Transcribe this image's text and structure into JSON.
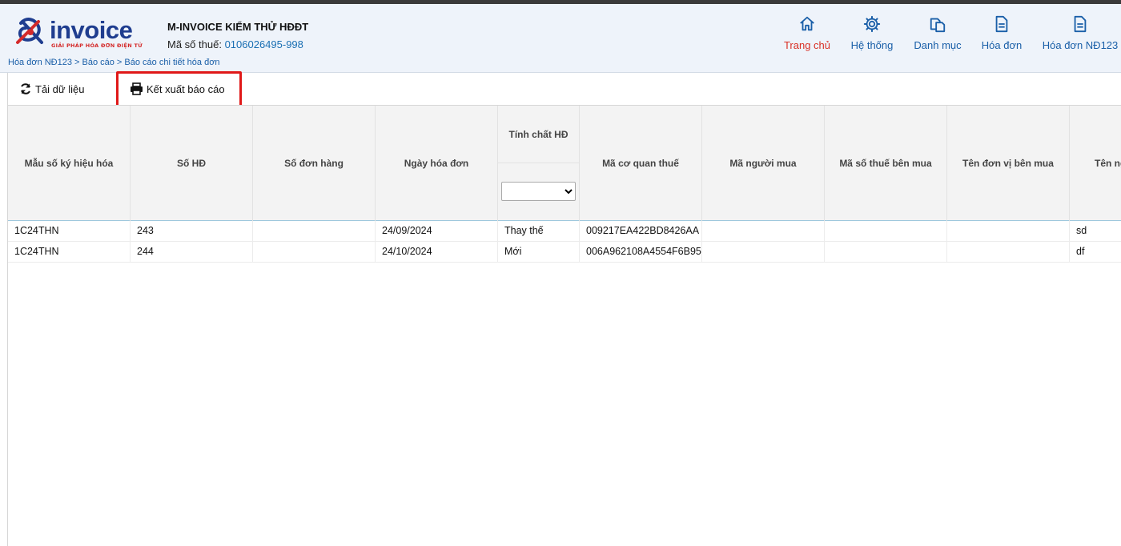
{
  "header": {
    "logo_text": "invoice",
    "logo_tagline": "GIẢI PHÁP HÓA ĐƠN ĐIỆN TỬ",
    "company_name": "M-INVOICE KIỂM THỬ HĐĐT",
    "tax_label": "Mã số thuế:",
    "tax_code": "0106026495-998",
    "breadcrumb": "Hóa đơn NĐ123 > Báo cáo > Báo cáo chi tiết hóa đơn"
  },
  "nav": [
    {
      "label": "Trang chủ",
      "icon": "home-icon",
      "active": true
    },
    {
      "label": "Hệ thống",
      "icon": "gear-icon",
      "active": false
    },
    {
      "label": "Danh mục",
      "icon": "documents-icon",
      "active": false
    },
    {
      "label": "Hóa đơn",
      "icon": "document-icon",
      "active": false
    },
    {
      "label": "Hóa đơn NĐ123",
      "icon": "document-icon",
      "active": false
    }
  ],
  "toolbar": {
    "reload_label": "Tải dữ liệu",
    "export_label": "Kết xuất báo cáo"
  },
  "table": {
    "columns": [
      "Mẫu số ký hiệu hóa",
      "Số HĐ",
      "Số đơn hàng",
      "Ngày hóa đơn",
      "Tính chất HĐ",
      "Mã cơ quan thuế",
      "Mã người mua",
      "Mã số thuế bên mua",
      "Tên đơn vị bên mua",
      "Tên người mua"
    ],
    "filter_value": "",
    "rows": [
      [
        "1C24THN",
        "243",
        "",
        "24/09/2024",
        "Thay thế",
        "009217EA422BD8426AA",
        "",
        "",
        "",
        "sd"
      ],
      [
        "1C24THN",
        "244",
        "",
        "24/10/2024",
        "Mới",
        "006A962108A4554F6B95",
        "",
        "",
        "",
        "df"
      ]
    ]
  },
  "colors": {
    "brand_blue": "#1f3d8f",
    "active_nav": "#d93025",
    "nav_blue": "#1a5fa8",
    "highlight": "#e01818"
  }
}
